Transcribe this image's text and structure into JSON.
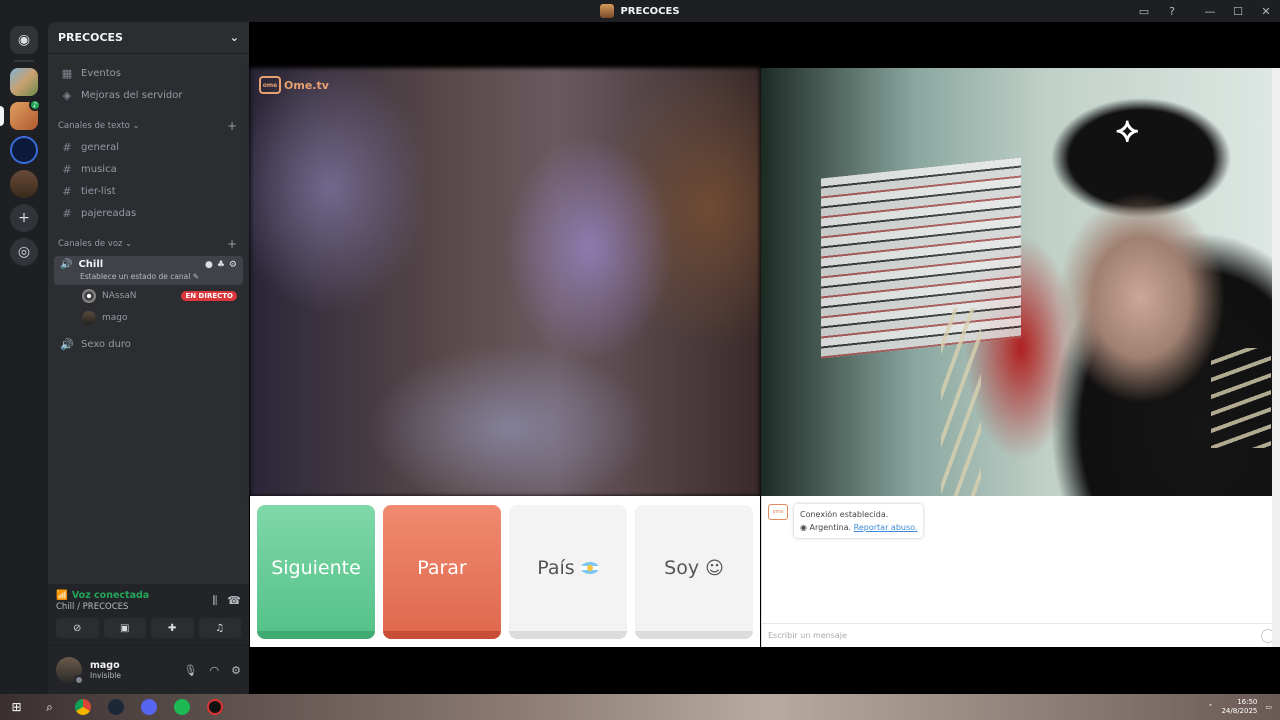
{
  "window": {
    "title": "PRECOCES"
  },
  "guild": {
    "name": "PRECOCES",
    "top_items": [
      {
        "label": "Eventos",
        "icon": "calendar-icon"
      },
      {
        "label": "Mejoras del servidor",
        "icon": "boost-icon"
      }
    ],
    "text_category": "Canales de texto",
    "text_channels": [
      "general",
      "musica",
      "tier-list",
      "pajereadas"
    ],
    "voice_category": "Canales de voz",
    "active_voice": {
      "name": "Chill",
      "status_placeholder": "Establece un estado de canal"
    },
    "voice_users": [
      {
        "name": "NAssaN",
        "live": "EN DIRECTO"
      },
      {
        "name": "mago",
        "live": ""
      }
    ],
    "other_voice": "Sexo duro"
  },
  "voice_panel": {
    "title": "Voz conectada",
    "subtitle": "Chill / PRECOCES"
  },
  "user_panel": {
    "name": "mago",
    "status": "Invisible"
  },
  "omegle": {
    "logo_text": "Ome.tv",
    "buttons": {
      "next": "Siguiente",
      "stop": "Parar",
      "country": "País",
      "me": "Soy"
    },
    "chat": {
      "line1": "Conexión establecida.",
      "country": "Argentina.",
      "report": "Reportar abuso.",
      "input_placeholder": "Escribir un mensaje"
    }
  },
  "taskbar": {
    "time": "16:50",
    "date": "24/8/2025"
  },
  "colors": {
    "discord_bg": "#2b2d31",
    "next_green": "#56c28a",
    "stop_red": "#e06a50",
    "live_red": "#da373c",
    "voice_green": "#23a55a"
  }
}
